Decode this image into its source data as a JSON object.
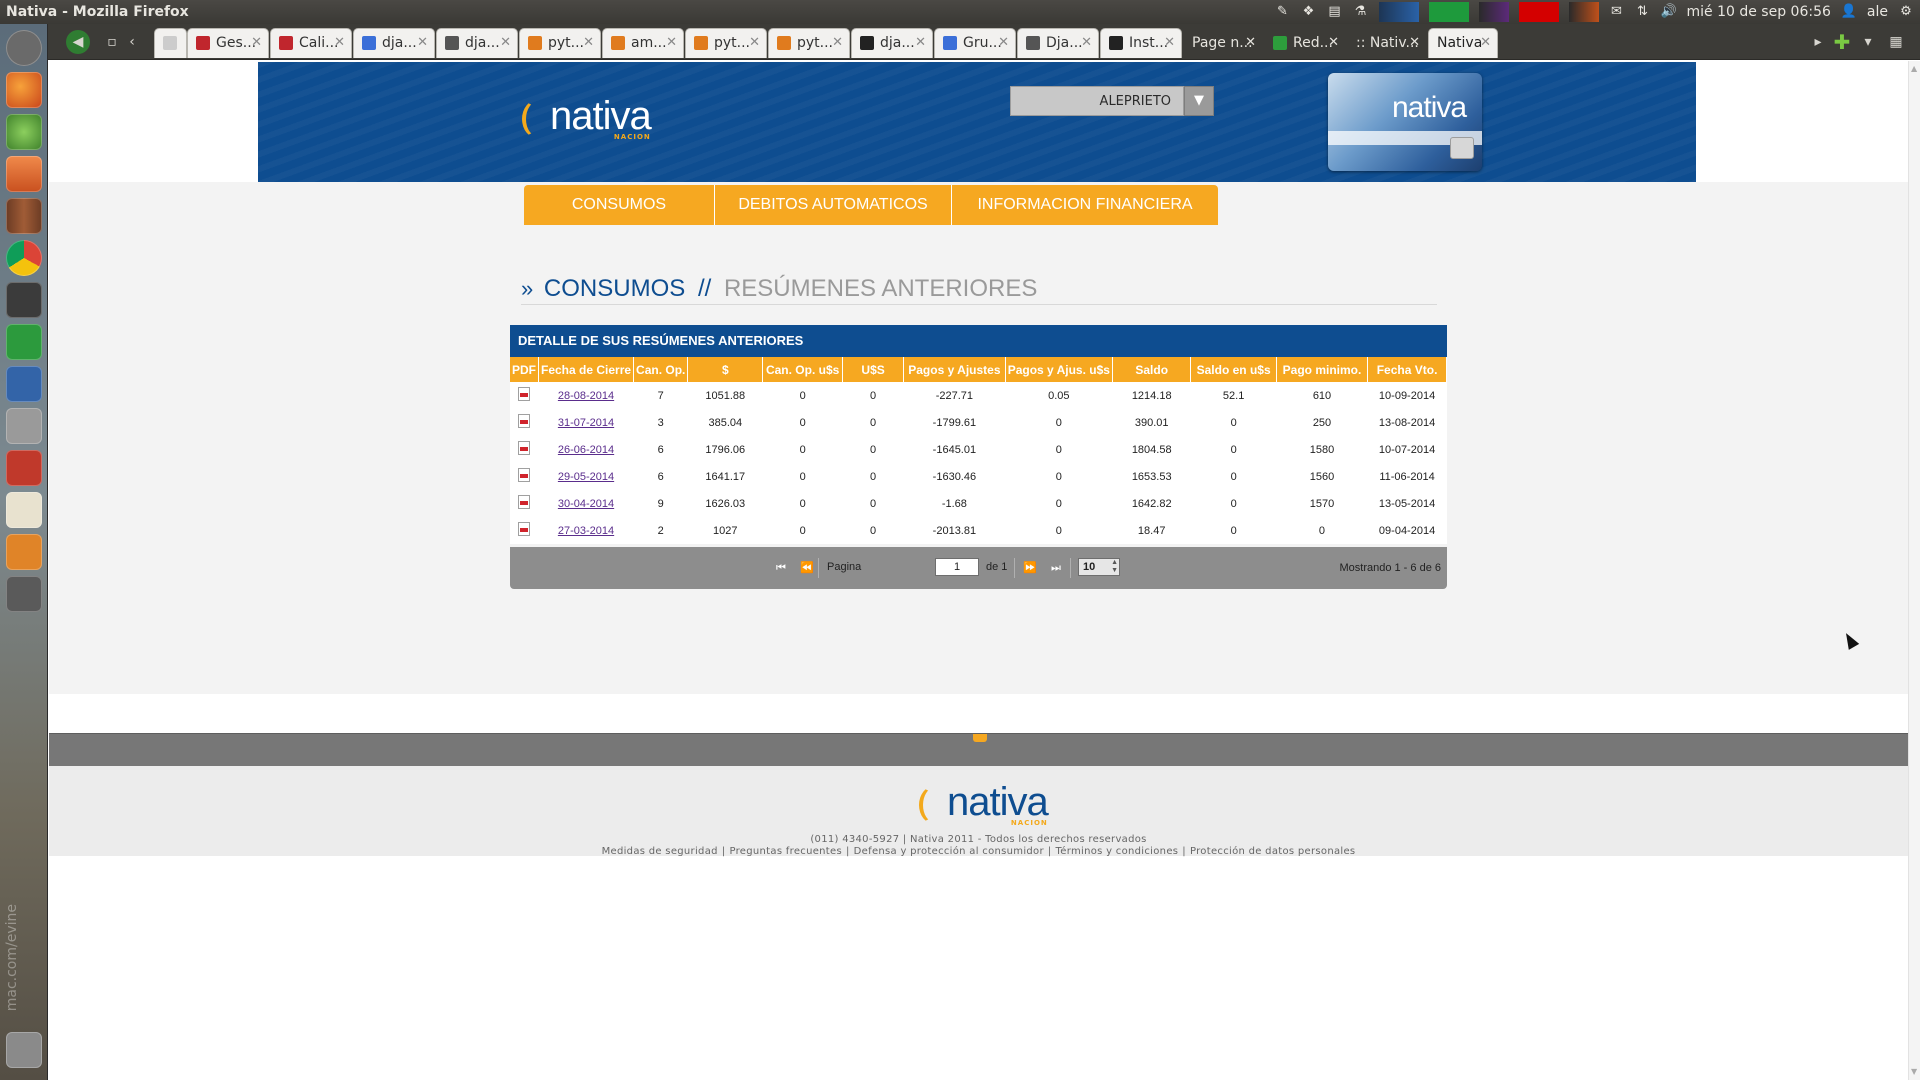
{
  "window": {
    "title": "Nativa - Mozilla Firefox"
  },
  "system_tray": {
    "clock": "mié 10 de sep 06:56",
    "user": "ale"
  },
  "tabs": [
    {
      "label": "",
      "icon_color": "#cccccc"
    },
    {
      "label": "Ges...",
      "icon_color": "#c0262d"
    },
    {
      "label": "Cali...",
      "icon_color": "#c0262d"
    },
    {
      "label": "dja...",
      "icon_color": "#3b6fd8"
    },
    {
      "label": "dja...",
      "icon_color": "#555555"
    },
    {
      "label": "pyt...",
      "icon_color": "#e07b1e"
    },
    {
      "label": "am...",
      "icon_color": "#e07b1e"
    },
    {
      "label": "pyt...",
      "icon_color": "#e07b1e"
    },
    {
      "label": "pyt...",
      "icon_color": "#e07b1e"
    },
    {
      "label": "dja...",
      "icon_color": "#222222"
    },
    {
      "label": "Gru...",
      "icon_color": "#3b6fd8"
    },
    {
      "label": "Dja...",
      "icon_color": "#555555"
    },
    {
      "label": "Inst...",
      "icon_color": "#222222"
    },
    {
      "label": "Page n..."
    },
    {
      "label": "Red...",
      "icon_color": "#2d9d3c"
    },
    {
      "label": ":: Nativ..."
    },
    {
      "label": "Nativa"
    }
  ],
  "header": {
    "logo_text": "nativa",
    "logo_tag": "NACION",
    "user_select_value": "ALEPRIETO",
    "card_text": "nativa"
  },
  "nav": {
    "items": [
      "CONSUMOS",
      "DEBITOS AUTOMATICOS",
      "INFORMACION FINANCIERA"
    ]
  },
  "page": {
    "title_raquo": "»",
    "title_main": "CONSUMOS",
    "title_sep": "//",
    "title_sub": "RESÚMENES ANTERIORES"
  },
  "table": {
    "caption": "DETALLE DE SUS RESÚMENES ANTERIORES",
    "columns": [
      "PDF",
      "Fecha de Cierre",
      "Can. Op.",
      "$",
      "Can. Op. u$s",
      "U$S",
      "Pagos y Ajustes",
      "Pagos y Ajus. u$s",
      "Saldo",
      "Saldo en u$s",
      "Pago minimo.",
      "Fecha Vto."
    ],
    "rows": [
      [
        "28-08-2014",
        "7",
        "1051.88",
        "0",
        "0",
        "-227.71",
        "0.05",
        "1214.18",
        "52.1",
        "610",
        "10-09-2014"
      ],
      [
        "31-07-2014",
        "3",
        "385.04",
        "0",
        "0",
        "-1799.61",
        "0",
        "390.01",
        "0",
        "250",
        "13-08-2014"
      ],
      [
        "26-06-2014",
        "6",
        "1796.06",
        "0",
        "0",
        "-1645.01",
        "0",
        "1804.58",
        "0",
        "1580",
        "10-07-2014"
      ],
      [
        "29-05-2014",
        "6",
        "1641.17",
        "0",
        "0",
        "-1630.46",
        "0",
        "1653.53",
        "0",
        "1560",
        "11-06-2014"
      ],
      [
        "30-04-2014",
        "9",
        "1626.03",
        "0",
        "0",
        "-1.68",
        "0",
        "1642.82",
        "0",
        "1570",
        "13-05-2014"
      ],
      [
        "27-03-2014",
        "2",
        "1027",
        "0",
        "0",
        "-2013.81",
        "0",
        "18.47",
        "0",
        "0",
        "09-04-2014"
      ]
    ]
  },
  "pager": {
    "page_label": "Pagina",
    "page_value": "1",
    "of_label": "de 1",
    "page_size": "10",
    "count_text": "Mostrando 1 - 6 de 6"
  },
  "footer": {
    "logo_text": "nativa",
    "logo_tag": "NACION",
    "copyright": "(011) 4340-5927 | Nativa 2011 - Todos los derechos reservados",
    "links": [
      "Medidas de seguridad",
      "Preguntas frecuentes",
      "Defensa y protección al consumidor",
      "Términos y condiciones",
      "Protección de datos personales"
    ]
  },
  "launcher": {
    "watermark": "mac.com/evine",
    "apps": [
      "dash",
      "firefox",
      "network",
      "files",
      "library",
      "chrome",
      "sublime",
      "calc",
      "virtualbox",
      "scanner",
      "install",
      "editor",
      "vlc",
      "workspaces",
      "trash"
    ]
  }
}
